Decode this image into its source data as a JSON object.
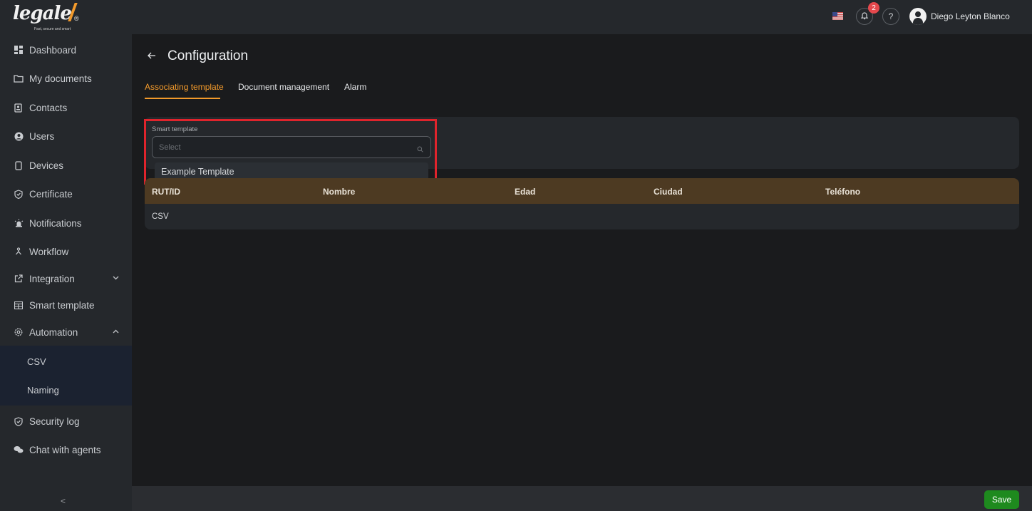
{
  "brand": {
    "name": "legale",
    "tagline": "Fast, secure and smart",
    "mark": "®"
  },
  "sidebar": {
    "items": [
      {
        "label": "Dashboard",
        "icon": "dashboard-icon"
      },
      {
        "label": "My documents",
        "icon": "folder-icon"
      },
      {
        "label": "Contacts",
        "icon": "contacts-icon"
      },
      {
        "label": "Users",
        "icon": "user-circle-icon"
      },
      {
        "label": "Devices",
        "icon": "device-icon"
      },
      {
        "label": "Certificate",
        "icon": "shield-check-icon"
      },
      {
        "label": "Notifications",
        "icon": "alarm-icon"
      },
      {
        "label": "Workflow",
        "icon": "workflow-icon"
      },
      {
        "label": "Integration",
        "icon": "external-link-icon"
      },
      {
        "label": "Smart template",
        "icon": "table-icon"
      },
      {
        "label": "Automation",
        "icon": "gear-icon"
      },
      {
        "label": "Security log",
        "icon": "shield-check-icon"
      },
      {
        "label": "Chat with agents",
        "icon": "chat-icon"
      }
    ],
    "automation_sub": [
      "CSV",
      "Naming"
    ],
    "collapse_label": "<"
  },
  "topbar": {
    "notification_count": "2",
    "help_label": "?",
    "user_name": "Diego Leyton Blanco"
  },
  "page": {
    "title": "Configuration",
    "tabs": [
      "Associating template",
      "Document management",
      "Alarm"
    ],
    "active_tab": "Associating template"
  },
  "form": {
    "field_label": "Smart template",
    "select_placeholder": "Select",
    "dropdown_options": [
      "Example Template"
    ]
  },
  "table": {
    "columns": [
      "RUT/ID",
      "Nombre",
      "Edad",
      "Ciudad",
      "Teléfono"
    ],
    "rows": [
      [
        "CSV",
        "",
        "",
        "",
        ""
      ]
    ]
  },
  "footer": {
    "save_label": "Save"
  },
  "colors": {
    "accent": "#f39a2b",
    "save": "#1e8a1e",
    "badge": "#e5484d",
    "highlight": "#e0242c"
  }
}
